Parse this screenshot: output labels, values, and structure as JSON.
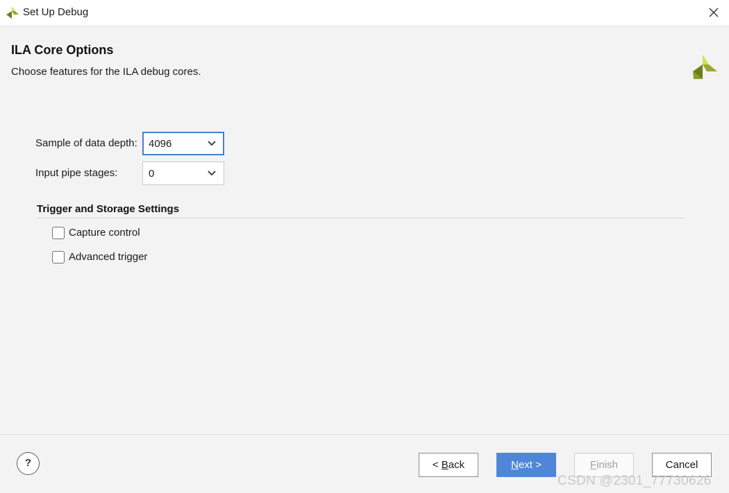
{
  "window": {
    "title": "Set Up Debug",
    "app_icon": "xilinx-logo-icon",
    "close_icon": "close-icon"
  },
  "header": {
    "title": "ILA Core Options",
    "subtitle": "Choose features for the ILA debug cores.",
    "logo": "xilinx-logo-icon",
    "logo_colors": [
      "#9aa830",
      "#d6e04a",
      "#6f7d1e"
    ]
  },
  "form": {
    "depth": {
      "label": "Sample of data depth:",
      "value": "4096"
    },
    "pipe": {
      "label": "Input pipe stages:",
      "value": "0"
    }
  },
  "trigger_section": {
    "title": "Trigger and Storage Settings",
    "options": [
      {
        "label": "Capture control",
        "checked": false
      },
      {
        "label": "Advanced trigger",
        "checked": false
      }
    ]
  },
  "footer": {
    "help_label": "?",
    "back": {
      "prefix": "< ",
      "mnemonic": "B",
      "rest": "ack"
    },
    "next": {
      "mnemonic": "N",
      "rest": "ext >"
    },
    "finish": {
      "mnemonic": "F",
      "rest": "inish",
      "disabled": true
    },
    "cancel": "Cancel"
  },
  "watermark": "CSDN @2301_77730626",
  "colors": {
    "accent": "#4f86d8",
    "focus_border": "#4a7ec9",
    "background": "#f3f3f3"
  }
}
